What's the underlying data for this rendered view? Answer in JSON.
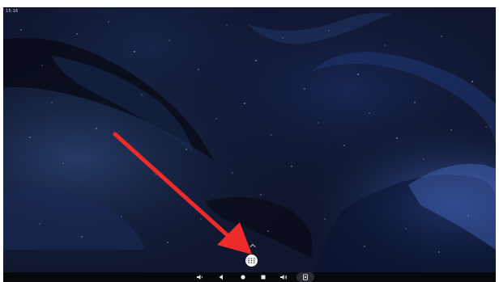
{
  "status_bar": {
    "time": "15:16"
  },
  "wallpaper": {
    "icon": "starry-galaxy-wallpaper",
    "colors": {
      "base": "#0c1022",
      "accent": "#1d3a7a",
      "highlight": "#8fa8e0"
    }
  },
  "annotation": {
    "icon": "red-arrow-pointer",
    "color": "#ee2b2b"
  },
  "app_drawer": {
    "icon": "apps-grid-icon",
    "handle_icon": "chevron-up-icon"
  },
  "navigation_bar": {
    "buttons": [
      {
        "name": "volume-down",
        "icon": "volume-down-icon"
      },
      {
        "name": "back",
        "icon": "back-triangle-icon"
      },
      {
        "name": "home",
        "icon": "home-circle-icon"
      },
      {
        "name": "recents",
        "icon": "recents-square-icon"
      },
      {
        "name": "volume-up",
        "icon": "volume-up-icon"
      },
      {
        "name": "screenshot",
        "icon": "screenshot-icon"
      }
    ]
  }
}
